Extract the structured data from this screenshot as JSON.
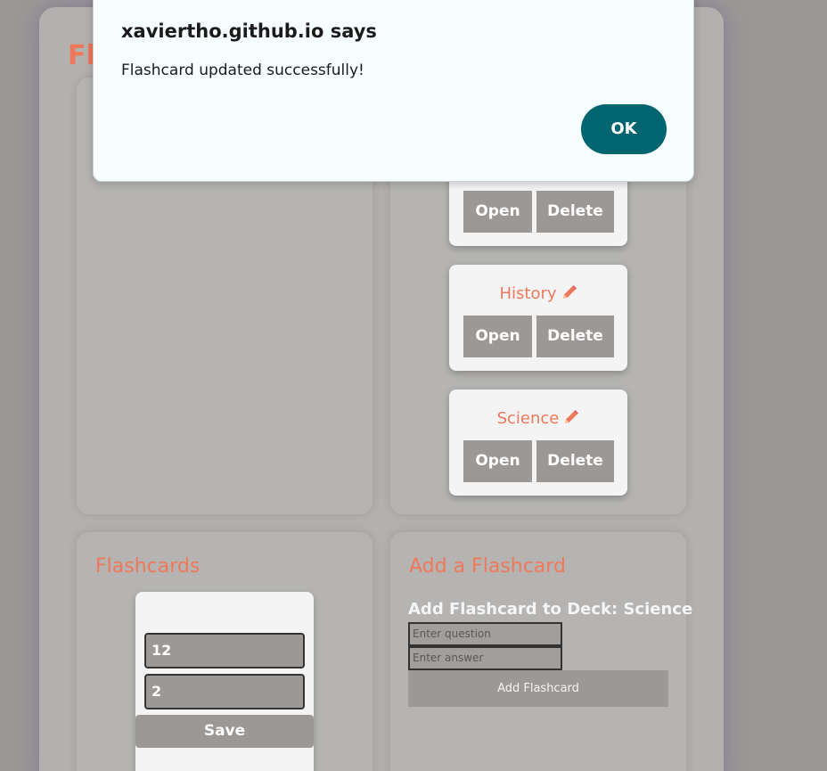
{
  "app": {
    "title": "Fl"
  },
  "decks": [
    {
      "name": "",
      "open_label": "Open",
      "delete_label": "Delete"
    },
    {
      "name": "History",
      "open_label": "Open",
      "delete_label": "Delete"
    },
    {
      "name": "Science",
      "open_label": "Open",
      "delete_label": "Delete"
    }
  ],
  "icons": {
    "edit": "pencil-icon"
  },
  "flashcards": {
    "heading": "Flashcards",
    "question_value": "12",
    "answer_value": "2",
    "save_label": "Save"
  },
  "add_flashcard": {
    "heading": "Add a Flashcard",
    "subheading": "Add Flashcard to Deck: Science",
    "question_placeholder": "Enter question",
    "answer_placeholder": "Enter answer",
    "button_label": "Add Flashcard"
  },
  "alert": {
    "title": "xaviertho.github.io says",
    "message": "Flashcard updated successfully!",
    "ok_label": "OK"
  },
  "colors": {
    "accent": "#f0785a",
    "button_gray": "#9c9896",
    "dialog_ok": "#03656f"
  }
}
